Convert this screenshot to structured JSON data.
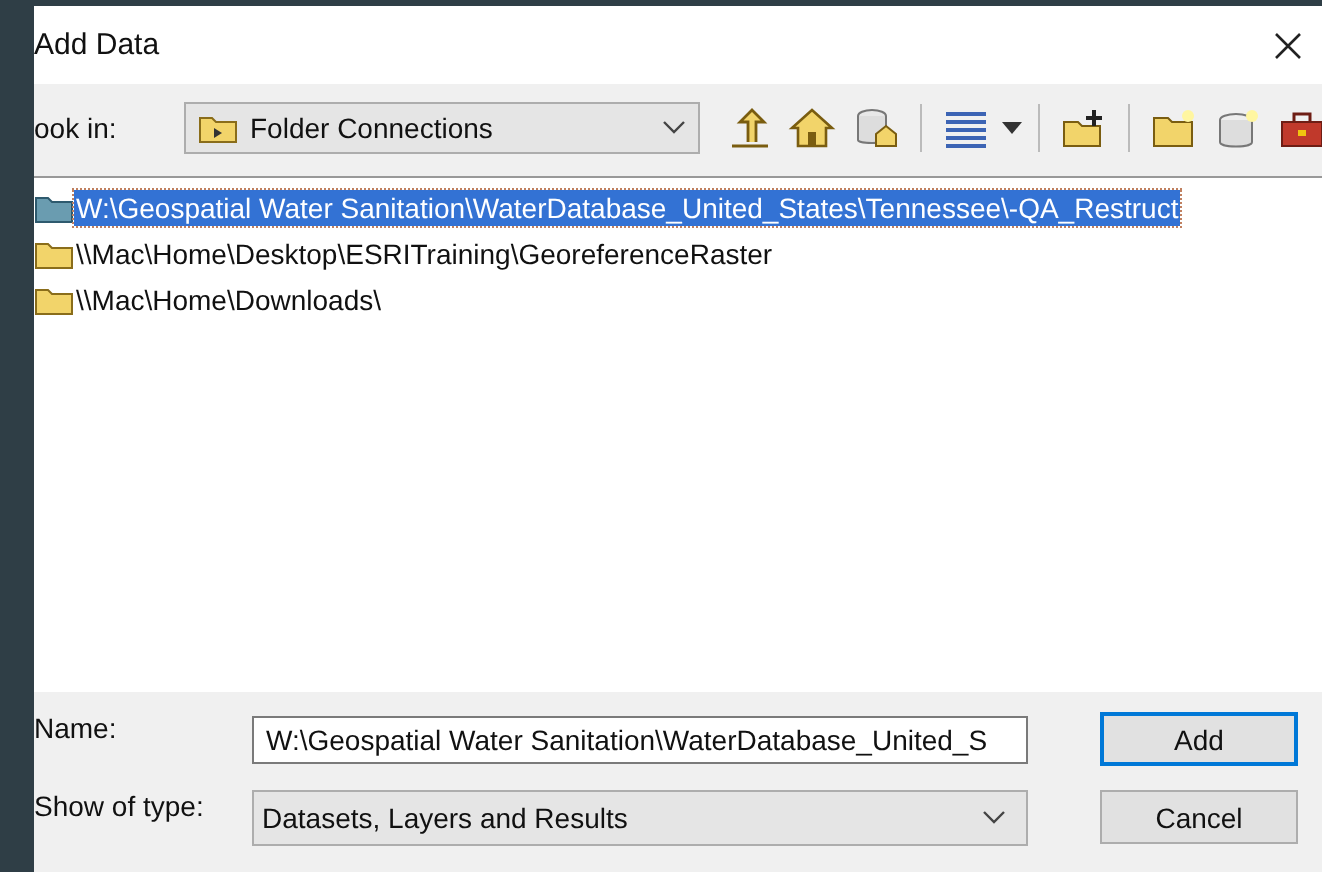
{
  "window": {
    "title": "Add Data"
  },
  "look_in": {
    "label": "ook in:",
    "value": "Folder Connections"
  },
  "items": [
    {
      "text": "W:\\Geospatial Water Sanitation\\WaterDatabase_United_States\\Tennessee\\-QA_Restruct",
      "selected": true
    },
    {
      "text": "\\\\Mac\\Home\\Desktop\\ESRITraining\\GeoreferenceRaster",
      "selected": false
    },
    {
      "text": "\\\\Mac\\Home\\Downloads\\",
      "selected": false
    }
  ],
  "name": {
    "label": "Name:",
    "value": "W:\\Geospatial Water Sanitation\\WaterDatabase_United_S"
  },
  "show_of_type": {
    "label": "Show of type:",
    "value": "Datasets, Layers and Results"
  },
  "buttons": [
    {
      "label": "Add",
      "kind": "default"
    },
    {
      "label": "Cancel",
      "kind": "normal"
    }
  ]
}
